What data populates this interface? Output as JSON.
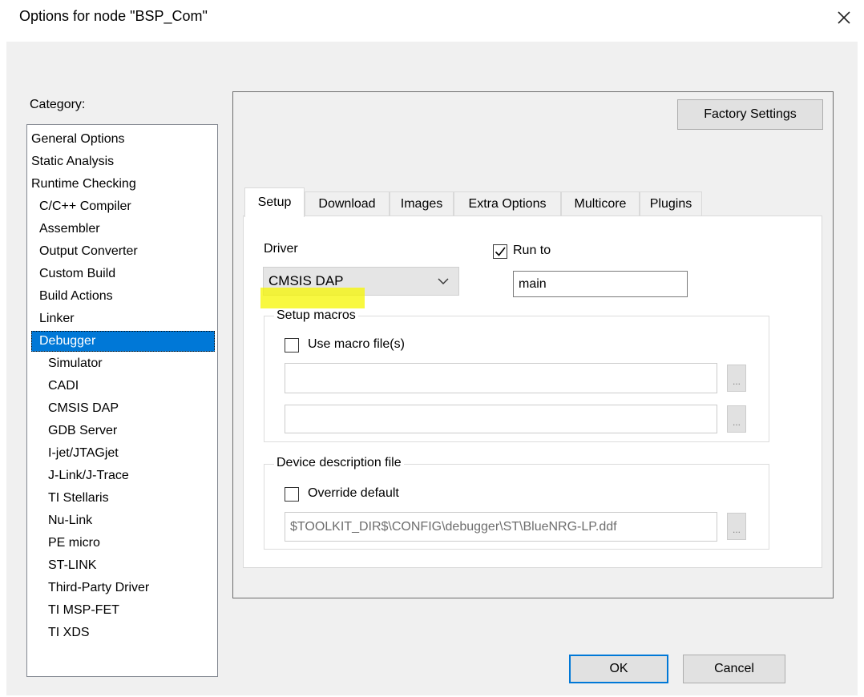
{
  "window": {
    "title": "Options for node \"BSP_Com\"",
    "close_icon": "close-icon"
  },
  "category": {
    "label": "Category:",
    "items": [
      "General Options",
      "Static Analysis",
      "Runtime Checking",
      "C/C++ Compiler",
      "Assembler",
      "Output Converter",
      "Custom Build",
      "Build Actions",
      "Linker",
      "Debugger",
      "Simulator",
      "CADI",
      "CMSIS DAP",
      "GDB Server",
      "I-jet/JTAGjet",
      "J-Link/J-Trace",
      "TI Stellaris",
      "Nu-Link",
      "PE micro",
      "ST-LINK",
      "Third-Party Driver",
      "TI MSP-FET",
      "TI XDS"
    ],
    "selected": "Debugger"
  },
  "factory_settings_label": "Factory Settings",
  "tabs": [
    "Setup",
    "Download",
    "Images",
    "Extra Options",
    "Multicore",
    "Plugins"
  ],
  "active_tab": "Setup",
  "setup": {
    "driver_label": "Driver",
    "driver_value": "CMSIS DAP",
    "run_to_label": "Run to",
    "run_to_checked": true,
    "run_to_value": "main",
    "setup_macros_title": "Setup macros",
    "use_macro_label": "Use macro file(s)",
    "use_macro_checked": false,
    "macro_file_1": "",
    "macro_file_2": "",
    "ellipsis_label": "...",
    "device_desc_title": "Device description file",
    "override_label": "Override default",
    "override_checked": false,
    "device_desc_value": "$TOOLKIT_DIR$\\CONFIG\\debugger\\ST\\BlueNRG-LP.ddf"
  },
  "buttons": {
    "ok": "OK",
    "cancel": "Cancel"
  },
  "colors": {
    "selection": "#0078d7",
    "highlight": "#f6f600"
  }
}
